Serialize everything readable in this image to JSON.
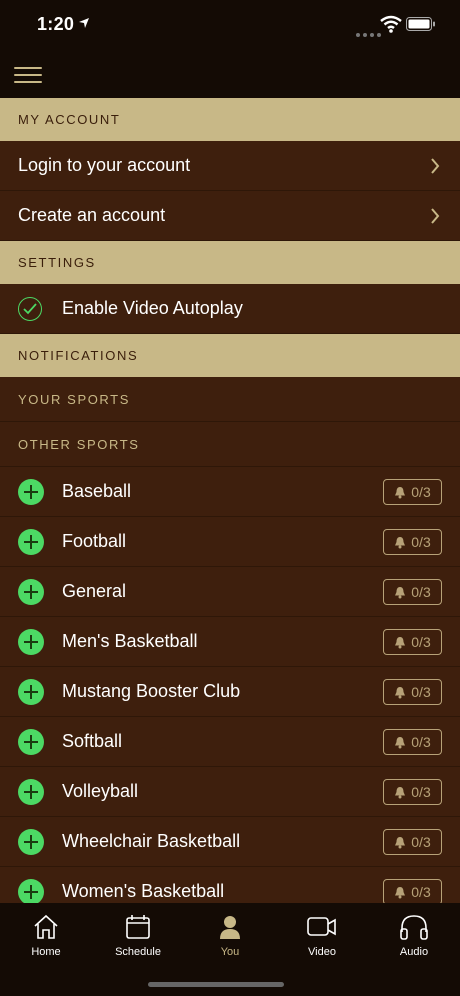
{
  "status": {
    "time": "1:20"
  },
  "sections": {
    "account": {
      "title": "MY ACCOUNT",
      "items": [
        "Login to your account",
        "Create an account"
      ]
    },
    "settings": {
      "title": "SETTINGS",
      "autoplay_label": "Enable Video Autoplay"
    },
    "notifications": {
      "title": "NOTIFICATIONS",
      "your_sports": "YOUR SPORTS",
      "other_sports": "OTHER SPORTS",
      "sports": [
        {
          "name": "Baseball",
          "count": "0/3"
        },
        {
          "name": "Football",
          "count": "0/3"
        },
        {
          "name": "General",
          "count": "0/3"
        },
        {
          "name": "Men's Basketball",
          "count": "0/3"
        },
        {
          "name": "Mustang Booster Club",
          "count": "0/3"
        },
        {
          "name": "Softball",
          "count": "0/3"
        },
        {
          "name": "Volleyball",
          "count": "0/3"
        },
        {
          "name": "Wheelchair Basketball",
          "count": "0/3"
        },
        {
          "name": "Women's Basketball",
          "count": "0/3"
        }
      ]
    }
  },
  "tabs": [
    {
      "label": "Home",
      "icon": "home-icon"
    },
    {
      "label": "Schedule",
      "icon": "calendar-icon"
    },
    {
      "label": "You",
      "icon": "person-icon"
    },
    {
      "label": "Video",
      "icon": "video-icon"
    },
    {
      "label": "Audio",
      "icon": "headphones-icon"
    }
  ],
  "colors": {
    "gold": "#c8b887",
    "brown": "#3e1f0d",
    "green": "#4cd964",
    "dark": "#140b05"
  }
}
